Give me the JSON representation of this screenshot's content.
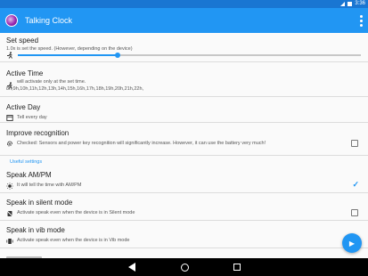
{
  "status_bar": {
    "time": "3:36"
  },
  "app_bar": {
    "title": "Talking Clock"
  },
  "prefs": {
    "speed": {
      "title": "Set speed",
      "summary": "1.0x is set the speed. (However, depending on the device)",
      "value_fraction": 0.29
    },
    "active_time": {
      "title": "Active Time",
      "line1": "will activate only at the set time.",
      "line2": "8h,9h,10h,11h,12h,13h,14h,15h,16h,17h,18h,19h,20h,21h,22h,"
    },
    "active_day": {
      "title": "Active Day",
      "summary": "Tell every day"
    },
    "improve": {
      "title": "Improve recognition",
      "summary": "Checked: Sensors and power key recognition will significantly increase. However, it can use the battery very much!",
      "checked": false
    },
    "category": "Useful settings",
    "ampm": {
      "title": "Speak AM/PM",
      "summary": "It will tell the time with AM/PM",
      "checked": true
    },
    "silent": {
      "title": "Speak in silent mode",
      "summary": "Activate speak even when the device is in Silent mode",
      "checked": false
    },
    "vib": {
      "title": "Speak in vib mode",
      "summary": "Activate speak even when the device is in Vib mode"
    }
  },
  "icons": {
    "check_mark": "✓",
    "fab": "▶"
  },
  "colors": {
    "primary": "#2196f3",
    "status_bar": "#1976d2"
  }
}
